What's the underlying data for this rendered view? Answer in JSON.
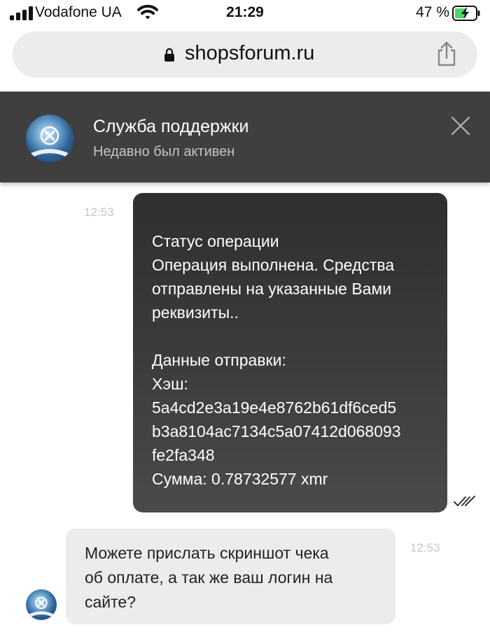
{
  "status_bar": {
    "carrier": "Vodafone UA",
    "time": "21:29",
    "battery": "47 %"
  },
  "browser": {
    "url": "shopsforum.ru"
  },
  "chat_header": {
    "title": "Служба поддержки",
    "subtitle": "Недавно был активен"
  },
  "messages": [
    {
      "time": "12:53",
      "text": "Статус операции\nОперация выполнена. Средства отправлены на указанные Вами реквизиты..\n\nДанные отправки:\nХэш:\n5a4cd2e3a19e4e8762b61df6ced5\nb3a8104ac7134c5a07412d068093\nfe2fa348\nСумма: 0.78732577 xmr"
    },
    {
      "time": "12:53",
      "text": "Можете прислать скриншот чека\nоб оплате, а так же ваш логин на\nсайте?"
    }
  ],
  "colors": {
    "header_bg": "#3f3f3f",
    "outgoing_bubble": "#3a3a3a",
    "incoming_bubble": "#ececec",
    "battery_green": "#4cd964"
  },
  "icons": [
    "signal-icon",
    "wifi-icon",
    "battery-icon",
    "lock-icon",
    "share-icon",
    "avatar",
    "close-icon",
    "double-check-icon"
  ]
}
